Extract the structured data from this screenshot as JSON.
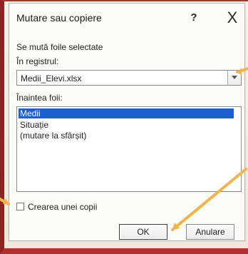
{
  "dialog": {
    "title": "Mutare sau copiere",
    "help_symbol": "?",
    "close_symbol": "X",
    "subtitle": "Se mută foile selectate",
    "registry_label": "În registrul:",
    "registry_value": "Medii_Elevi.xlsx",
    "before_sheet_label": "Înaintea foii:",
    "sheet_list": [
      "Medii",
      "Situație",
      "(mutare la sfârșit)"
    ],
    "selected_sheet": "Medii",
    "create_copy_label": "Crearea unei copii",
    "ok_label": "OK",
    "cancel_label": "Anulare"
  },
  "colors": {
    "selection": "#1c5fd1",
    "annotation_arrow": "#f3b24a",
    "page_border_red": "#b32f2a"
  }
}
